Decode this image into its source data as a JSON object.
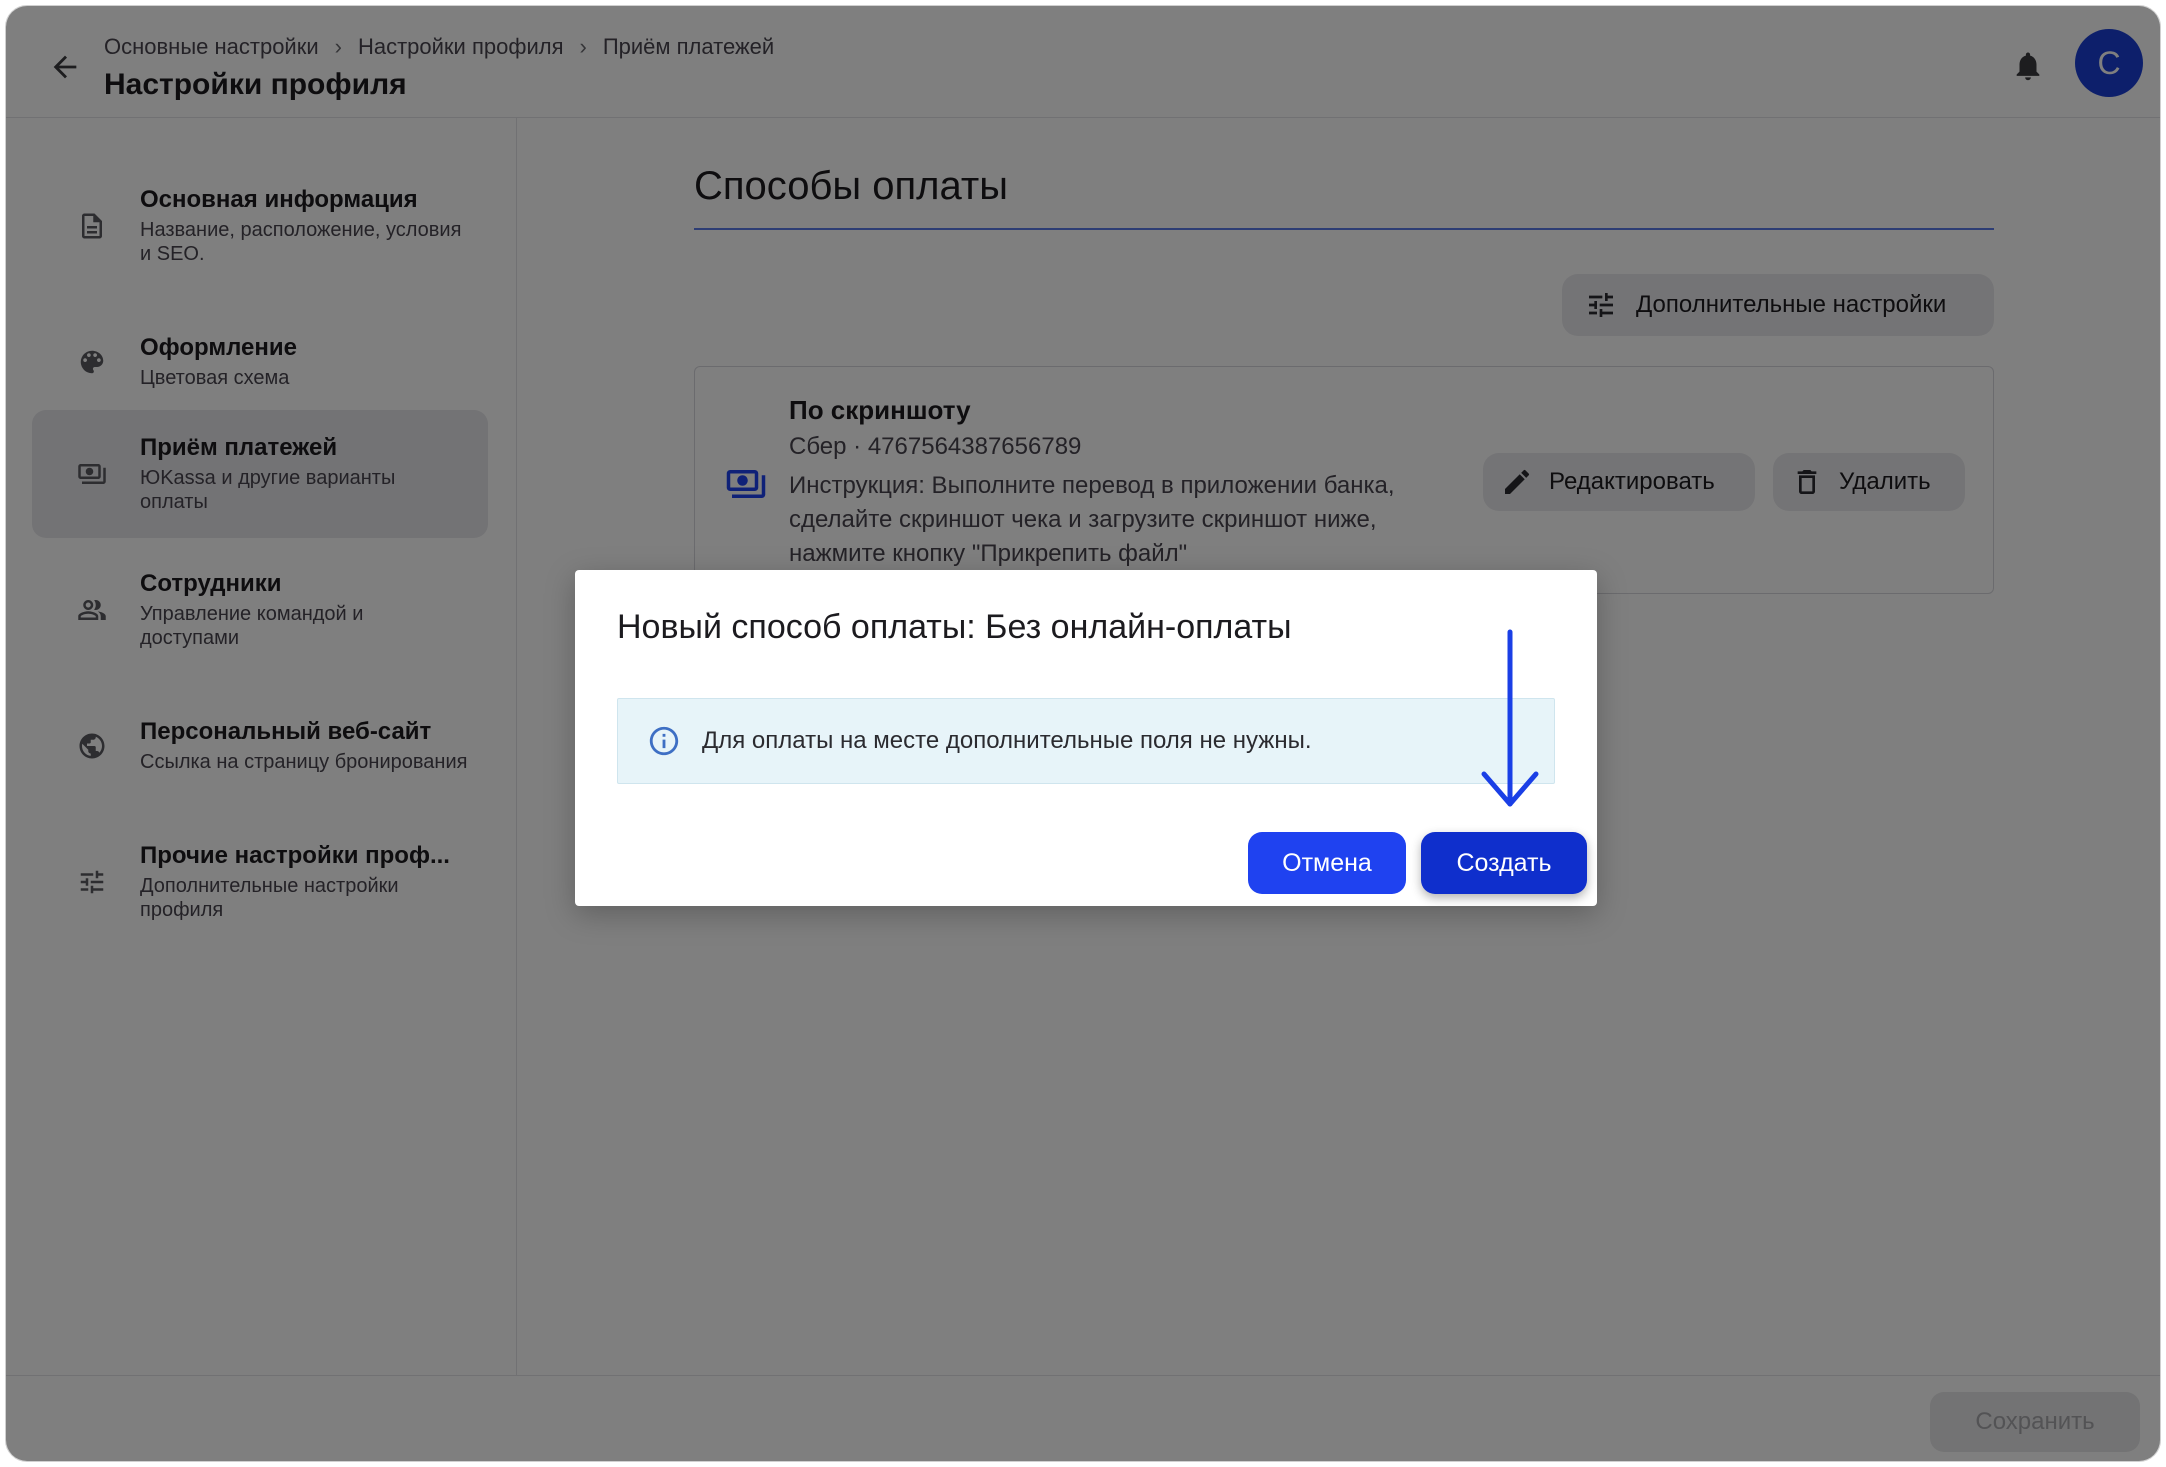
{
  "header": {
    "breadcrumb": [
      "Основные настройки",
      "Настройки профиля",
      "Приём платежей"
    ],
    "breadcrumb_separator": "›",
    "title": "Настройки профиля",
    "avatar_letter": "С"
  },
  "sidebar": {
    "items": [
      {
        "title": "Основная информация",
        "subtitle": "Название, расположение, условия и SEO.",
        "icon": "document-icon",
        "active": false
      },
      {
        "title": "Оформление",
        "subtitle": "Цветовая схема",
        "icon": "palette-icon",
        "active": false
      },
      {
        "title": "Приём платежей",
        "subtitle": "ЮKassa и другие варианты оплаты",
        "icon": "payments-icon",
        "active": true
      },
      {
        "title": "Сотрудники",
        "subtitle": "Управление командой и доступами",
        "icon": "people-icon",
        "active": false
      },
      {
        "title": "Персональный веб-сайт",
        "subtitle": "Ссылка на страницу бронирования",
        "icon": "globe-icon",
        "active": false
      },
      {
        "title": "Прочие настройки проф...",
        "subtitle": "Дополнительные настройки профиля",
        "icon": "tune-icon",
        "active": false
      }
    ]
  },
  "main": {
    "section_title": "Способы оплаты",
    "extra_settings_label": "Дополнительные настройки",
    "payment_card": {
      "name": "По скриншоту",
      "bank": "Сбер · 4767564387656789",
      "instruction": "Инструкция: Выполните перевод в приложении банка, сделайте скриншот чека и загрузите скриншот ниже, нажмите кнопку \"Прикрепить файл\"",
      "edit_label": "Редактировать",
      "delete_label": "Удалить"
    }
  },
  "footer": {
    "save_label": "Сохранить"
  },
  "dialog": {
    "title": "Новый способ оплаты: Без онлайн-оплаты",
    "info_text": "Для оплаты на месте дополнительные поля не нужны.",
    "cancel_label": "Отмена",
    "create_label": "Создать"
  },
  "colors": {
    "accent": "#1f42f0",
    "accent_dark": "#0f2fcc",
    "annotation_arrow": "#1a3fe6",
    "info_bg": "#e7f4f9"
  }
}
